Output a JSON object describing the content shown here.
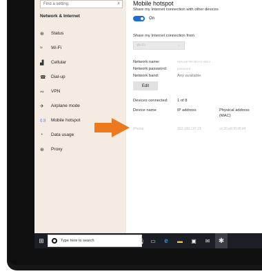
{
  "sidebar": {
    "search_placeholder": "Find a setting",
    "heading": "Network & Internet",
    "items": [
      {
        "label": "Status",
        "icon": "globe-status-icon",
        "glyph": "⊕"
      },
      {
        "label": "Wi-Fi",
        "icon": "wifi-icon",
        "glyph": "≈"
      },
      {
        "label": "Cellular",
        "icon": "cellular-signal-icon",
        "glyph": "▟"
      },
      {
        "label": "Dial-up",
        "icon": "dial-up-phone-icon",
        "glyph": "☎"
      },
      {
        "label": "VPN",
        "icon": "vpn-icon",
        "glyph": "∾"
      },
      {
        "label": "Airplane mode",
        "icon": "airplane-icon",
        "glyph": "✈"
      },
      {
        "label": "Mobile hotspot",
        "icon": "mobile-hotspot-icon",
        "glyph": "((·))"
      },
      {
        "label": "Data usage",
        "icon": "data-usage-icon",
        "glyph": "◔"
      },
      {
        "label": "Proxy",
        "icon": "proxy-globe-icon",
        "glyph": "⊕"
      }
    ]
  },
  "content": {
    "title": "Mobile hotspot",
    "share_description": "Share my Internet connection with other devices",
    "toggle_state": "On",
    "share_from_label": "Share my Internet connection from",
    "share_from_value": "Wi-Fi",
    "network_name_label": "Network name:",
    "network_name_value": "WIN-8KTRV9OAC-MDA",
    "network_password_label": "Network password:",
    "network_password_value": "password",
    "network_band_label": "Network band:",
    "network_band_value": "Any available",
    "edit_label": "Edit",
    "devices_connected_label": "Devices connected:",
    "devices_connected_value": "1 of 8",
    "columns": {
      "device_name": "Device name",
      "ip_address": "IP address",
      "physical_address": "Physical address\n(MAC)"
    },
    "device_row": {
      "device_name": "iPhone",
      "ip_address": "192.168.137.21",
      "mac": "cc:20:e8:95:f8:d4"
    }
  },
  "taskbar": {
    "search_placeholder": "Type here to search"
  },
  "colors": {
    "accent": "#1f6fd1",
    "sidebar_bg": "#f4ece2",
    "arrow": "#ec7a1c",
    "taskbar_bg": "#1b1e25"
  }
}
